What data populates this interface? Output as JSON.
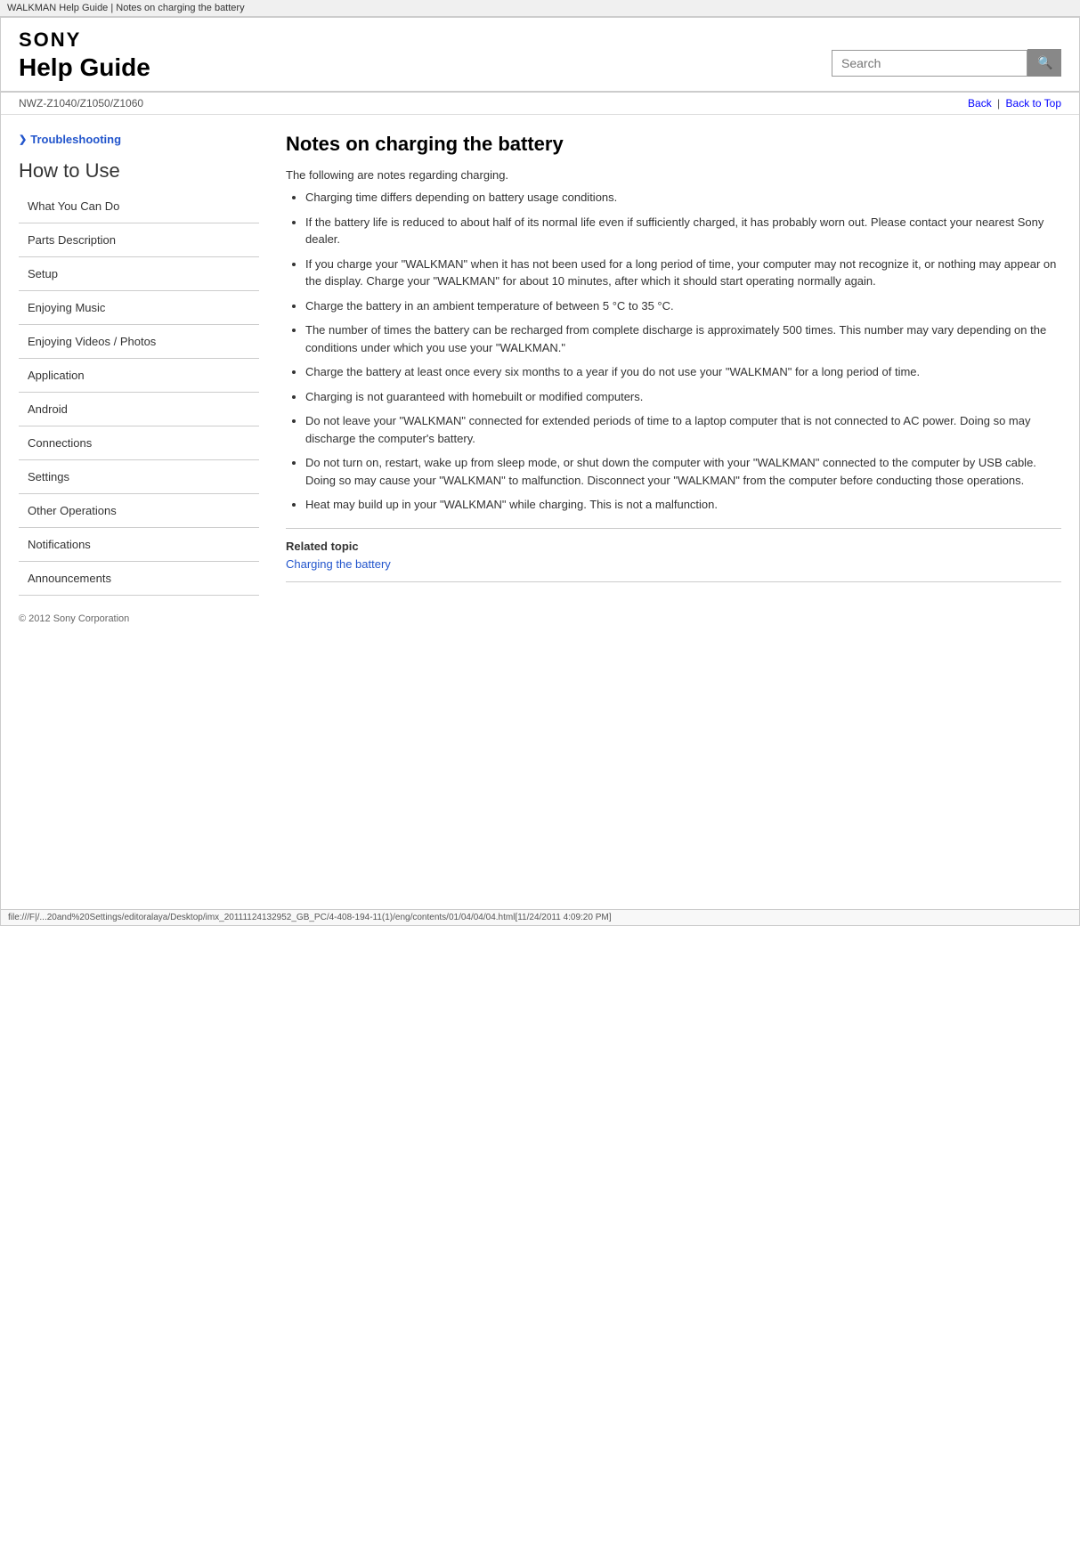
{
  "browser_title": "WALKMAN Help Guide | Notes on charging the battery",
  "header": {
    "sony_logo": "SONY",
    "help_guide_label": "Help Guide",
    "search_placeholder": "Search",
    "search_button_icon": "search"
  },
  "nav": {
    "model_number": "NWZ-Z1040/Z1050/Z1060",
    "back_link": "Back",
    "back_to_top_link": "Back to Top",
    "separator": "|"
  },
  "sidebar": {
    "troubleshooting_label": "Troubleshooting",
    "how_to_use_label": "How to Use",
    "items": [
      {
        "label": "What You Can Do"
      },
      {
        "label": "Parts Description"
      },
      {
        "label": "Setup"
      },
      {
        "label": "Enjoying Music"
      },
      {
        "label": "Enjoying Videos / Photos"
      },
      {
        "label": "Application"
      },
      {
        "label": "Android"
      },
      {
        "label": "Connections"
      },
      {
        "label": "Settings"
      },
      {
        "label": "Other Operations"
      },
      {
        "label": "Notifications"
      },
      {
        "label": "Announcements"
      }
    ],
    "footer": "© 2012 Sony Corporation"
  },
  "article": {
    "title": "Notes on charging the battery",
    "intro": "The following are notes regarding charging.",
    "bullets": [
      "Charging time differs depending on battery usage conditions.",
      "If the battery life is reduced to about half of its normal life even if sufficiently charged, it has probably worn out. Please contact your nearest Sony dealer.",
      "If you charge your \"WALKMAN\" when it has not been used for a long period of time, your computer may not recognize it, or nothing may appear on the display. Charge your \"WALKMAN\" for about 10 minutes, after which it should start operating normally again.",
      "Charge the battery in an ambient temperature of between 5 °C to 35 °C.",
      "The number of times the battery can be recharged from complete discharge is approximately 500 times. This number may vary depending on the conditions under which you use your \"WALKMAN.\"",
      "Charge the battery at least once every six months to a year if you do not use your \"WALKMAN\" for a long period of time.",
      "Charging is not guaranteed with homebuilt or modified computers.",
      "Do not leave your \"WALKMAN\" connected for extended periods of time to a laptop computer that is not connected to AC power. Doing so may discharge the computer's battery.",
      "Do not turn on, restart, wake up from sleep mode, or shut down the computer with your \"WALKMAN\" connected to the computer by USB cable. Doing so may cause your \"WALKMAN\" to malfunction. Disconnect your \"WALKMAN\" from the computer before conducting those operations.",
      "Heat may build up in your \"WALKMAN\" while charging. This is not a malfunction."
    ],
    "related_label": "Related topic",
    "related_link_text": "Charging the battery"
  },
  "bottom_bar": {
    "path": "file:///F|/...20and%20Settings/editoralaya/Desktop/imx_20111124132952_GB_PC/4-408-194-11(1)/eng/contents/01/04/04/04.html[11/24/2011 4:09:20 PM]"
  }
}
